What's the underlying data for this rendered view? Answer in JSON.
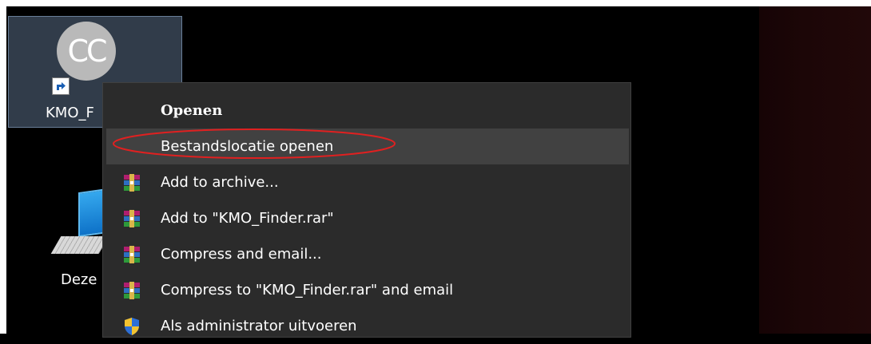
{
  "desktop": {
    "icons": [
      {
        "label": "KMO_Finder",
        "badge_text": "CC",
        "selected": true
      },
      {
        "label": "Deze pc",
        "selected": false
      }
    ]
  },
  "context_menu": {
    "items": [
      {
        "label": "Openen",
        "bold": true,
        "icon": "none"
      },
      {
        "label": "Bestandslocatie openen",
        "highlighted": true,
        "annotated": true,
        "icon": "none"
      },
      {
        "label": "Add to archive...",
        "icon": "winrar-icon"
      },
      {
        "label": "Add to \"KMO_Finder.rar\"",
        "icon": "winrar-icon"
      },
      {
        "label": "Compress and email...",
        "icon": "winrar-icon"
      },
      {
        "label": "Compress to \"KMO_Finder.rar\" and email",
        "icon": "winrar-icon"
      },
      {
        "label": "Als administrator uitvoeren",
        "icon": "shield-icon"
      }
    ]
  },
  "colors": {
    "menu_background": "#2b2b2b",
    "menu_highlight": "#414141",
    "annotation": "#e02020",
    "selection": "#5a6e87"
  }
}
